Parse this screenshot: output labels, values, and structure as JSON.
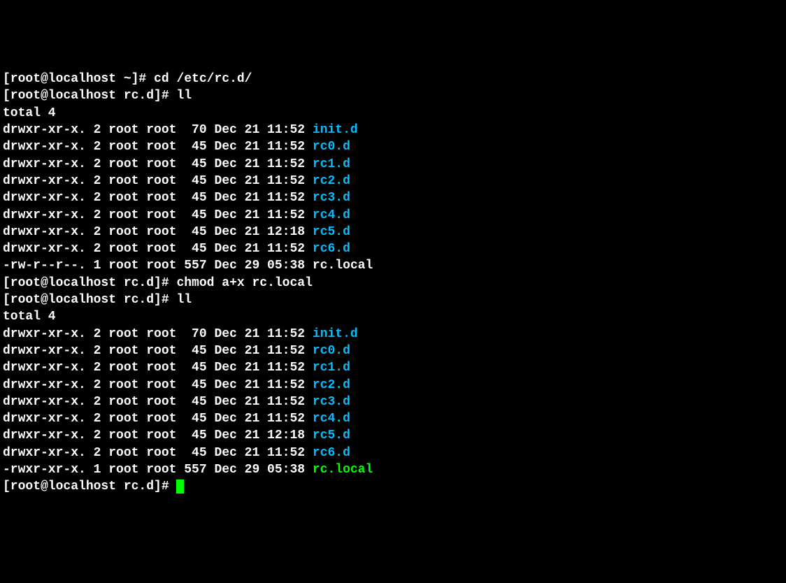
{
  "lines": [
    {
      "prompt": "[root@localhost ~]# ",
      "cmd": "cd /etc/rc.d/"
    },
    {
      "prompt": "[root@localhost rc.d]# ",
      "cmd": "ll"
    },
    {
      "text": "total 4"
    },
    {
      "perm": "drwxr-xr-x. 2 root root  70 Dec 21 11:52 ",
      "name": "init.d",
      "cls": "cyan"
    },
    {
      "perm": "drwxr-xr-x. 2 root root  45 Dec 21 11:52 ",
      "name": "rc0.d",
      "cls": "cyan"
    },
    {
      "perm": "drwxr-xr-x. 2 root root  45 Dec 21 11:52 ",
      "name": "rc1.d",
      "cls": "cyan"
    },
    {
      "perm": "drwxr-xr-x. 2 root root  45 Dec 21 11:52 ",
      "name": "rc2.d",
      "cls": "cyan"
    },
    {
      "perm": "drwxr-xr-x. 2 root root  45 Dec 21 11:52 ",
      "name": "rc3.d",
      "cls": "cyan"
    },
    {
      "perm": "drwxr-xr-x. 2 root root  45 Dec 21 11:52 ",
      "name": "rc4.d",
      "cls": "cyan"
    },
    {
      "perm": "drwxr-xr-x. 2 root root  45 Dec 21 12:18 ",
      "name": "rc5.d",
      "cls": "cyan"
    },
    {
      "perm": "drwxr-xr-x. 2 root root  45 Dec 21 11:52 ",
      "name": "rc6.d",
      "cls": "cyan"
    },
    {
      "perm": "-rw-r--r--. 1 root root 557 Dec 29 05:38 ",
      "name": "rc.local",
      "cls": ""
    },
    {
      "prompt": "[root@localhost rc.d]# ",
      "cmd": "chmod a+x rc.local"
    },
    {
      "prompt": "[root@localhost rc.d]# ",
      "cmd": "ll"
    },
    {
      "text": "total 4"
    },
    {
      "perm": "drwxr-xr-x. 2 root root  70 Dec 21 11:52 ",
      "name": "init.d",
      "cls": "cyan"
    },
    {
      "perm": "drwxr-xr-x. 2 root root  45 Dec 21 11:52 ",
      "name": "rc0.d",
      "cls": "cyan"
    },
    {
      "perm": "drwxr-xr-x. 2 root root  45 Dec 21 11:52 ",
      "name": "rc1.d",
      "cls": "cyan"
    },
    {
      "perm": "drwxr-xr-x. 2 root root  45 Dec 21 11:52 ",
      "name": "rc2.d",
      "cls": "cyan"
    },
    {
      "perm": "drwxr-xr-x. 2 root root  45 Dec 21 11:52 ",
      "name": "rc3.d",
      "cls": "cyan"
    },
    {
      "perm": "drwxr-xr-x. 2 root root  45 Dec 21 11:52 ",
      "name": "rc4.d",
      "cls": "cyan"
    },
    {
      "perm": "drwxr-xr-x. 2 root root  45 Dec 21 12:18 ",
      "name": "rc5.d",
      "cls": "cyan"
    },
    {
      "perm": "drwxr-xr-x. 2 root root  45 Dec 21 11:52 ",
      "name": "rc6.d",
      "cls": "cyan"
    },
    {
      "perm": "-rwxr-xr-x. 1 root root 557 Dec 29 05:38 ",
      "name": "rc.local",
      "cls": "green"
    },
    {
      "prompt": "[root@localhost rc.d]# ",
      "cmd": "",
      "cursor": true
    }
  ]
}
